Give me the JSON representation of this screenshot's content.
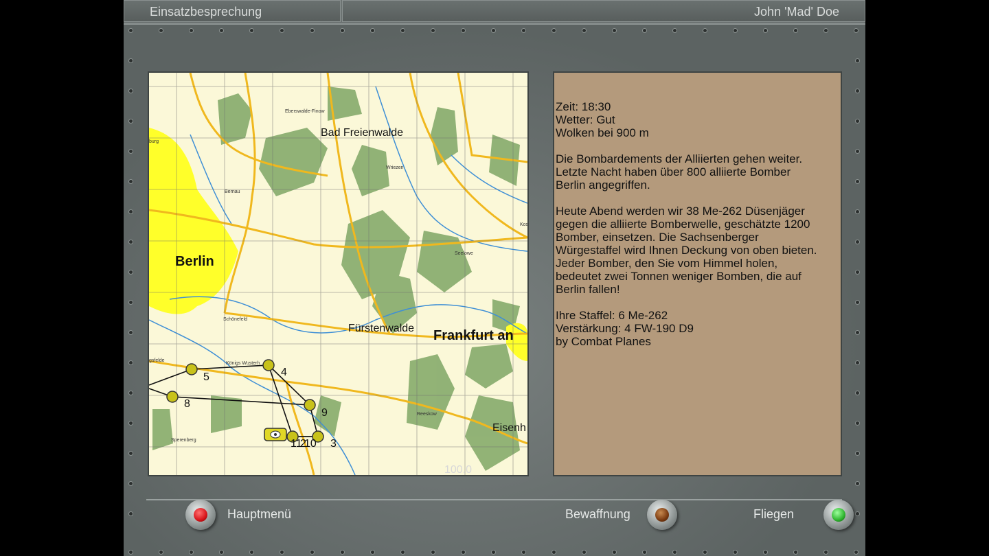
{
  "title_bar": {
    "screen_title": "Einsatzbesprechung",
    "pilot_name": "John 'Mad' Doe"
  },
  "map": {
    "cities_large": [
      "Berlin",
      "Frankfurt an"
    ],
    "cities_medium": [
      "Bad Freienwalde",
      "Fürstenwalde",
      "Eisenh"
    ],
    "towns_small": [
      "Eberswalde-Finow",
      "Wriezen",
      "Bernau",
      "Seelowe",
      "Schönefeld",
      "Königs Wusterh",
      "Reeskow",
      "Sperenberg",
      "gsfelde",
      "burg",
      "Kos"
    ],
    "waypoints": [
      "5",
      "4",
      "8",
      "9",
      "11",
      "2",
      "10",
      "3"
    ],
    "scale_label": "100.0"
  },
  "briefing": {
    "paragraphs": [
      [
        "Zeit: 18:30",
        "Wetter: Gut",
        "Wolken bei 900 m"
      ],
      [
        "Die Bombardements der Alliierten gehen weiter.",
        "Letzte Nacht haben über 800 alliierte Bomber",
        "Berlin angegriffen."
      ],
      [
        "Heute Abend werden wir 38 Me-262 Düsenjäger",
        "gegen die alliierte Bomberwelle, geschätzte 1200",
        "Bomber, einsetzen. Die Sachsenberger",
        "Würgestaffel wird Ihnen Deckung von oben bieten.",
        "Jeder Bomber, den Sie vom Himmel holen,",
        "bedeutet zwei Tonnen weniger Bomben, die auf",
        "Berlin fallen!"
      ],
      [
        "Ihre Staffel: 6 Me-262",
        "Verstärkung: 4 FW-190 D9",
        "by Combat Planes"
      ]
    ]
  },
  "buttons": {
    "main_menu": {
      "label": "Hauptmenü",
      "lamp_color": "#d8141a"
    },
    "armament": {
      "label": "Bewaffnung",
      "lamp_color": "#7a3a10"
    },
    "fly": {
      "label": "Fliegen",
      "lamp_color": "#2fb52f"
    }
  },
  "colors": {
    "map_paper": "#fbf8d8",
    "city_yellow": "#ffff2a",
    "road_orange": "#f0b81e",
    "forest_green": "#86ab6c",
    "water_blue": "#3e8fd6",
    "briefing_bg": "#b49a7c"
  }
}
